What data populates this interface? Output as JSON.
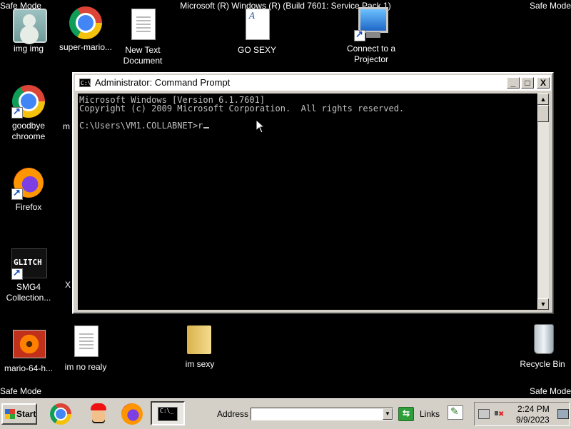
{
  "screen": {
    "top_title": "Microsoft (R) Windows (R) (Build 7601: Service Pack 1)",
    "safe_mode_label": "Safe Mode"
  },
  "desktop_icons": [
    {
      "label": "img img",
      "icon": "user-picture-icon"
    },
    {
      "label": "super-mario...",
      "icon": "chrome-icon"
    },
    {
      "label": "New Text Document",
      "icon": "text-document-icon"
    },
    {
      "label": "GO SEXY",
      "icon": "wordpad-document-icon"
    },
    {
      "label": "Connect to a Projector",
      "icon": "projector-icon"
    },
    {
      "label": "goodbye chroome",
      "icon": "chrome-icon"
    },
    {
      "label": "m",
      "icon": "partially-hidden-icon"
    },
    {
      "label": "Firefox",
      "icon": "firefox-icon"
    },
    {
      "label": "SMG4 Collection...",
      "icon": "glitch-logo-icon"
    },
    {
      "label": "X",
      "icon": "partially-hidden-icon"
    },
    {
      "label": "mario-64-h...",
      "icon": "image-file-icon"
    },
    {
      "label": "im no realy",
      "icon": "text-document-icon"
    },
    {
      "label": "im sexy",
      "icon": "folder-icon"
    },
    {
      "label": "Recycle Bin",
      "icon": "recycle-bin-icon"
    }
  ],
  "cmd_window": {
    "title": "Administrator: Command Prompt",
    "icon_text": "C:\\_",
    "lines": [
      "Microsoft Windows [Version 6.1.7601]",
      "Copyright (c) 2009 Microsoft Corporation.  All rights reserved.",
      "",
      "C:\\Users\\VM1.COLLABNET>r"
    ],
    "buttons": {
      "minimize": "_",
      "maximize": "□",
      "close": "X"
    }
  },
  "taskbar": {
    "start_label": "Start",
    "quick_launch": [
      "chrome-icon",
      "mario-icon",
      "firefox-icon"
    ],
    "active_task": {
      "icon": "command-prompt-icon",
      "icon_text": "C:\\_"
    },
    "address_label": "Address",
    "address_value": "",
    "links_label": "Links",
    "clock_time": "2:24 PM",
    "clock_date": "9/9/2023"
  }
}
